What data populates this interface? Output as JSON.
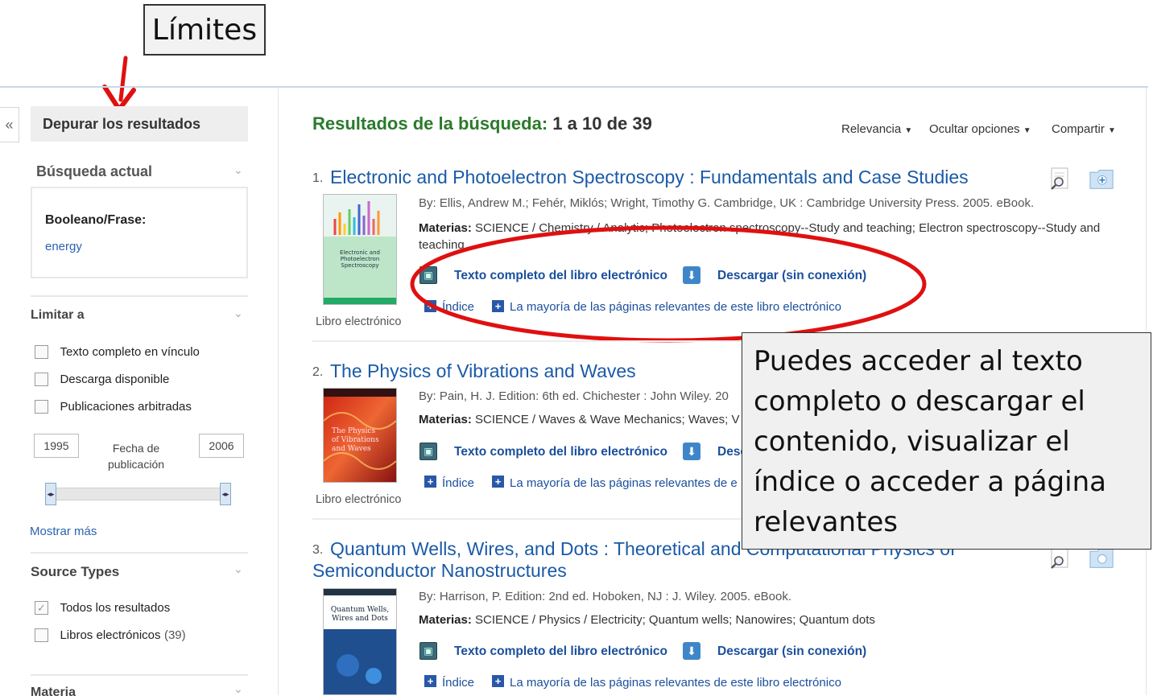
{
  "annotations": {
    "limits_label": "Límites",
    "info_text": "Puedes acceder al texto completo o descargar el contenido, visualizar el índice o acceder a página relevantes"
  },
  "sidebar": {
    "collapse_icon": "«",
    "refine_title": "Depurar los resultados",
    "current_search_title": "Búsqueda actual",
    "boolean_label": "Booleano/Frase:",
    "boolean_term": "energy",
    "limit_title": "Limitar a",
    "limits": [
      {
        "label": "Texto completo en vínculo",
        "checked": false
      },
      {
        "label": "Descarga disponible",
        "checked": false
      },
      {
        "label": "Publicaciones arbitradas",
        "checked": false
      }
    ],
    "year_from": "1995",
    "year_to": "2006",
    "date_label_1": "Fecha de",
    "date_label_2": "publicación",
    "show_more": "Mostrar más",
    "source_types_title": "Source Types",
    "source_types": [
      {
        "label": "Todos los resultados",
        "count": "",
        "checked": true
      },
      {
        "label": "Libros electrónicos",
        "count": "(39)",
        "checked": false
      }
    ],
    "subject_title": "Materia"
  },
  "results_header": {
    "label": "Resultados de la búsqueda:",
    "range": "1 a 10 de 39",
    "sort": "Relevancia",
    "hide_options": "Ocultar opciones",
    "share": "Compartir"
  },
  "results": [
    {
      "num": "1.",
      "title": "Electronic and Photoelectron Spectroscopy : Fundamentals and Case Studies",
      "title_line2": "",
      "meta": "By: Ellis, Andrew M.; Fehér, Miklós; Wright, Timothy G. Cambridge, UK : Cambridge University Press. 2005. eBook.",
      "subjects_label": "Materias:",
      "subjects": "SCIENCE / Chemistry / Analytic; Photoelectron spectroscopy--Study and teaching; Electron spectroscopy--Study and teaching",
      "full_text": "Texto completo del libro electrónico",
      "download": "Descargar (sin conexión)",
      "index": "Índice",
      "relevant": "La mayoría de las páginas relevantes de este libro electrónico",
      "type": "Libro electrónico"
    },
    {
      "num": "2.",
      "title": "The Physics of Vibrations and Waves",
      "title_line2": "",
      "meta": "By: Pain, H. J. Edition: 6th ed. Chichester : John Wiley. 20",
      "subjects_label": "Materias:",
      "subjects": "SCIENCE / Waves & Wave Mechanics; Waves; V",
      "full_text": "Texto completo del libro electrónico",
      "download": "Desc",
      "index": "Índice",
      "relevant": "La mayoría de las páginas relevantes de e",
      "type": "Libro electrónico"
    },
    {
      "num": "3.",
      "title": "Quantum Wells, Wires, and Dots : Theoretical and Computational Physics of",
      "title_line2": "Semiconductor Nanostructures",
      "meta": "By: Harrison, P. Edition: 2nd ed. Hoboken, NJ : J. Wiley. 2005. eBook.",
      "subjects_label": "Materias:",
      "subjects": "SCIENCE / Physics / Electricity; Quantum wells; Nanowires; Quantum dots",
      "full_text": "Texto completo del libro electrónico",
      "download": "Descargar (sin conexión)",
      "index": "Índice",
      "relevant": "La mayoría de las páginas relevantes de este libro electrónico",
      "type": ""
    }
  ],
  "covers": {
    "c1": "Electronic and Photoelectron Spectroscopy",
    "c2": "The Physics of Vibrations and Waves",
    "c3": "Quantum Wells, Wires and Dots"
  },
  "colors": {
    "accent_green": "#2c7a2c",
    "link_blue": "#1a5aa8",
    "highlight_red": "#e01010"
  }
}
